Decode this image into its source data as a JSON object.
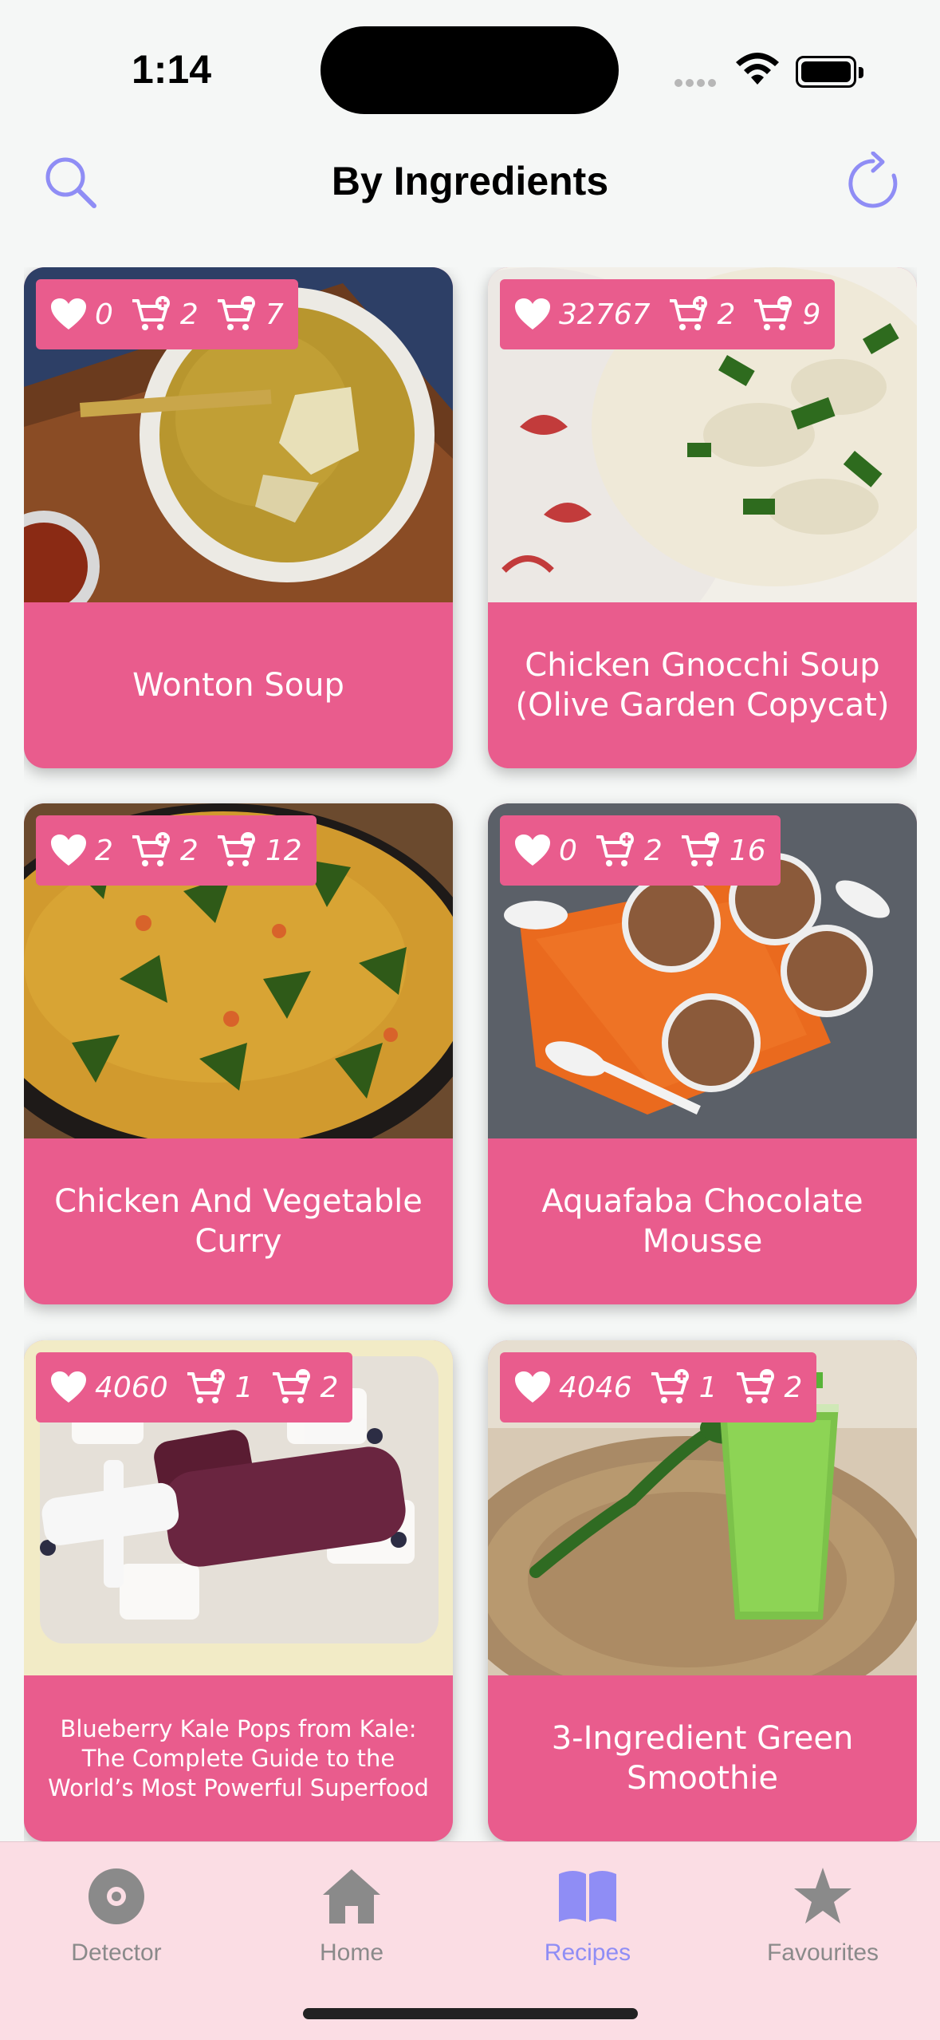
{
  "status": {
    "time": "1:14"
  },
  "header": {
    "title": "By Ingredients"
  },
  "recipes": [
    {
      "name": "Wonton Soup",
      "likes": "0",
      "added": "2",
      "missing": "7"
    },
    {
      "name": "Chicken Gnocchi Soup (Olive Garden Copycat)",
      "likes": "32767",
      "added": "2",
      "missing": "9"
    },
    {
      "name": "Chicken And Vegetable Curry",
      "likes": "2",
      "added": "2",
      "missing": "12"
    },
    {
      "name": "Aquafaba Chocolate Mousse",
      "likes": "0",
      "added": "2",
      "missing": "16"
    },
    {
      "name": "Blueberry Kale Pops from Kale: The Complete Guide to the World’s Most Powerful Superfood",
      "likes": "4060",
      "added": "1",
      "missing": "2"
    },
    {
      "name": "3-Ingredient Green Smoothie",
      "likes": "4046",
      "added": "1",
      "missing": "2"
    }
  ],
  "tabs": [
    {
      "label": "Detector",
      "icon": "detector-icon",
      "active": false
    },
    {
      "label": "Home",
      "icon": "home-icon",
      "active": false
    },
    {
      "label": "Recipes",
      "icon": "book-icon",
      "active": true
    },
    {
      "label": "Favourites",
      "icon": "star-icon",
      "active": false
    }
  ],
  "colors": {
    "card": "#e95c8d",
    "accent": "#8f8df5",
    "tab_inactive": "#8a8a8a",
    "tabbar_bg": "#fbdde4"
  }
}
